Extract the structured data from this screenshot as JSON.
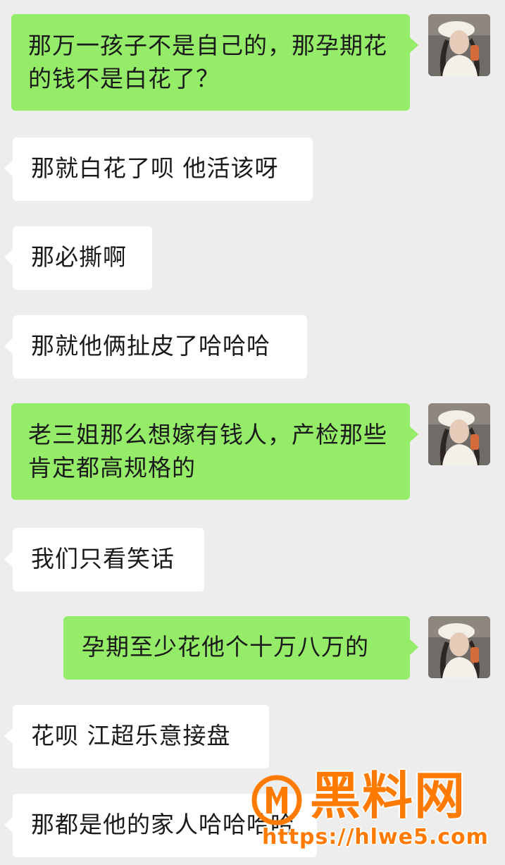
{
  "messages": [
    {
      "side": "out",
      "text": "那万一孩子不是自己的，那孕期花的钱不是白花了？"
    },
    {
      "side": "in",
      "text": "那就白花了呗 他活该呀"
    },
    {
      "side": "in",
      "text": "那必撕啊"
    },
    {
      "side": "in",
      "text": "那就他俩扯皮了哈哈哈"
    },
    {
      "side": "out",
      "text": "老三姐那么想嫁有钱人，产检那些肯定都高规格的"
    },
    {
      "side": "in",
      "text": "我们只看笑话"
    },
    {
      "side": "out",
      "text": "孕期至少花他个十万八万的"
    },
    {
      "side": "in",
      "text": "花呗  江超乐意接盘"
    },
    {
      "side": "in",
      "text": "那都是他的家人哈哈哈哈"
    }
  ],
  "watermark": {
    "title": "黑料网",
    "url": "https://hlwe5.com"
  },
  "colors": {
    "background": "#ededed",
    "bubble_in": "#ffffff",
    "bubble_out": "#95ec69",
    "watermark": "#ff7a00"
  },
  "icons": {
    "avatar": "user-avatar-photo",
    "watermark_logo": "brand-logo-icon"
  }
}
